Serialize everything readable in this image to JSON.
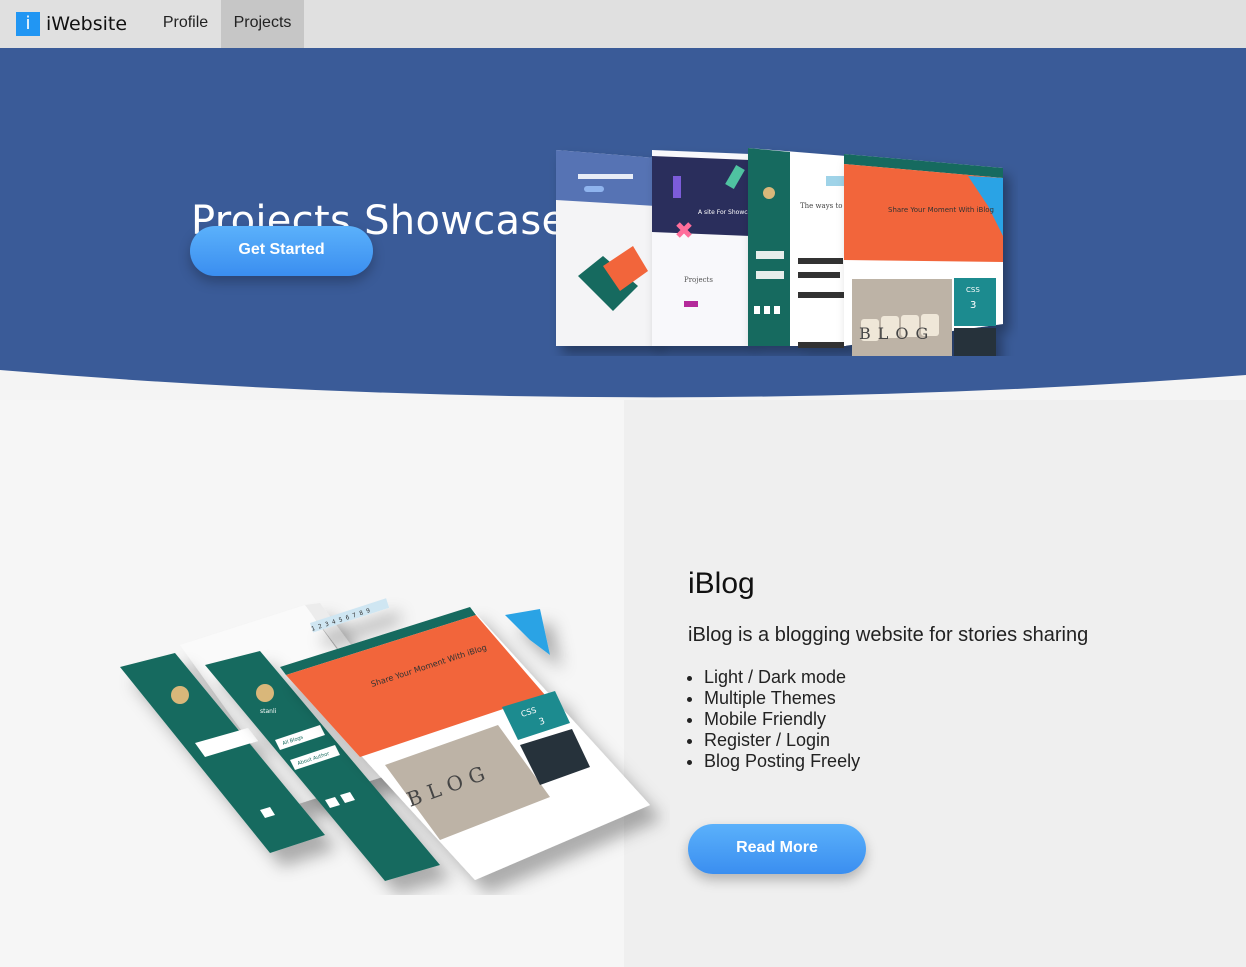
{
  "nav": {
    "brand_icon": "i",
    "brand_name": "iWebsite",
    "links": [
      {
        "label": "Profile",
        "active": false
      },
      {
        "label": "Projects",
        "active": true
      }
    ]
  },
  "hero": {
    "title": "Projects Showcase",
    "button_label": "Get Started",
    "background": "#3a5b98",
    "mockup_texts": {
      "banner_title": "Share Your Moment With iBlog",
      "blog_word": "BLOG",
      "css_badge": "CSS",
      "css_number": "3",
      "projects_label": "Projects",
      "tag_text": "A site For Showcasing",
      "ways_text": "The ways to remove"
    }
  },
  "project": {
    "name": "iBlog",
    "description": "iBlog is a blogging website for stories sharing",
    "features": [
      "Light / Dark mode",
      "Multiple Themes",
      "Mobile Friendly",
      "Register / Login",
      "Blog Posting Freely"
    ],
    "button_label": "Read More",
    "mockup_texts": {
      "banner_title": "Share Your Moment With iBlog",
      "blog_word": "BLOG",
      "css_badge": "CSS",
      "css_number": "3",
      "pager": "1 2 3 4 5 6 7 8 9",
      "avatar_name": "stanli",
      "menu_items": [
        "All Blogs",
        "About Author"
      ]
    }
  },
  "colors": {
    "accent": "#2196f3",
    "button": "#4aa0f6",
    "teal": "#176b5e",
    "orange": "#f2653a",
    "nav": "#e0e0e0"
  }
}
